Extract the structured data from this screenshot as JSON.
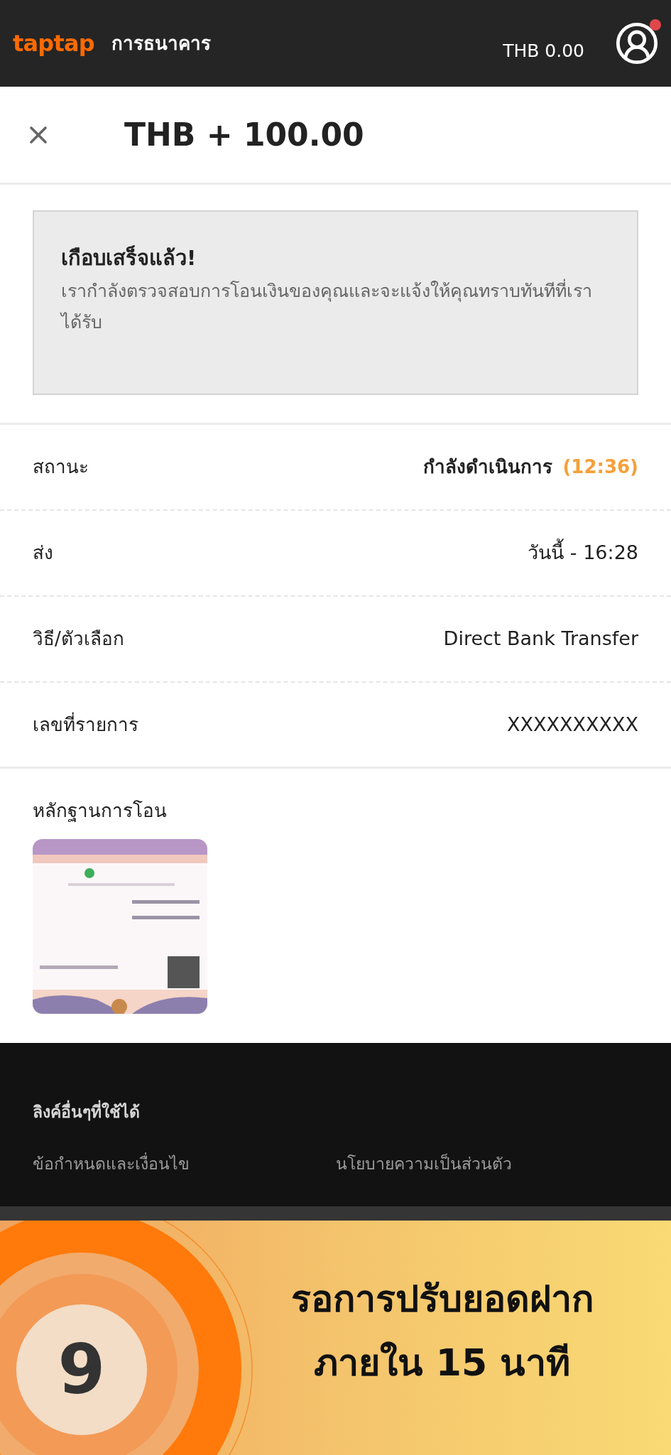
{
  "header": {
    "logo": "taptap",
    "title": "การธนาคาร",
    "balance": "THB 0.00",
    "has_notification": true
  },
  "transaction": {
    "amount": "THB + 100.00"
  },
  "notice": {
    "title": "เกือบเสร็จแล้ว!",
    "message": "เรากำลังตรวจสอบการโอนเงินของคุณและจะแจ้งให้คุณทราบทันทีที่เราได้รับ"
  },
  "details": [
    {
      "label": "สถานะ",
      "value": "กำลังดำเนินการ",
      "timer": "(12:36)",
      "kind": "status"
    },
    {
      "label": "ส่ง",
      "value": "วันนี้ - 16:28",
      "kind": "plain"
    },
    {
      "label": "วิธี/ตัวเลือก",
      "value": "Direct Bank Transfer",
      "kind": "plain"
    },
    {
      "label": "เลขที่รายการ",
      "value": "XXXXXXXXXX",
      "kind": "plain"
    }
  ],
  "proof": {
    "label": "หลักฐานการโอน",
    "kind": "picture"
  },
  "footer": {
    "heading": "ลิงค์อื่นๆที่ใช้ได้",
    "links": [
      "ข้อกำหนดและเงื่อนไข",
      "นโยบายความเป็นส่วนตัว"
    ]
  },
  "banner": {
    "step": "9",
    "lines": [
      "รอการปรับยอดฝาก",
      "ภายใน 15 นาที"
    ]
  }
}
